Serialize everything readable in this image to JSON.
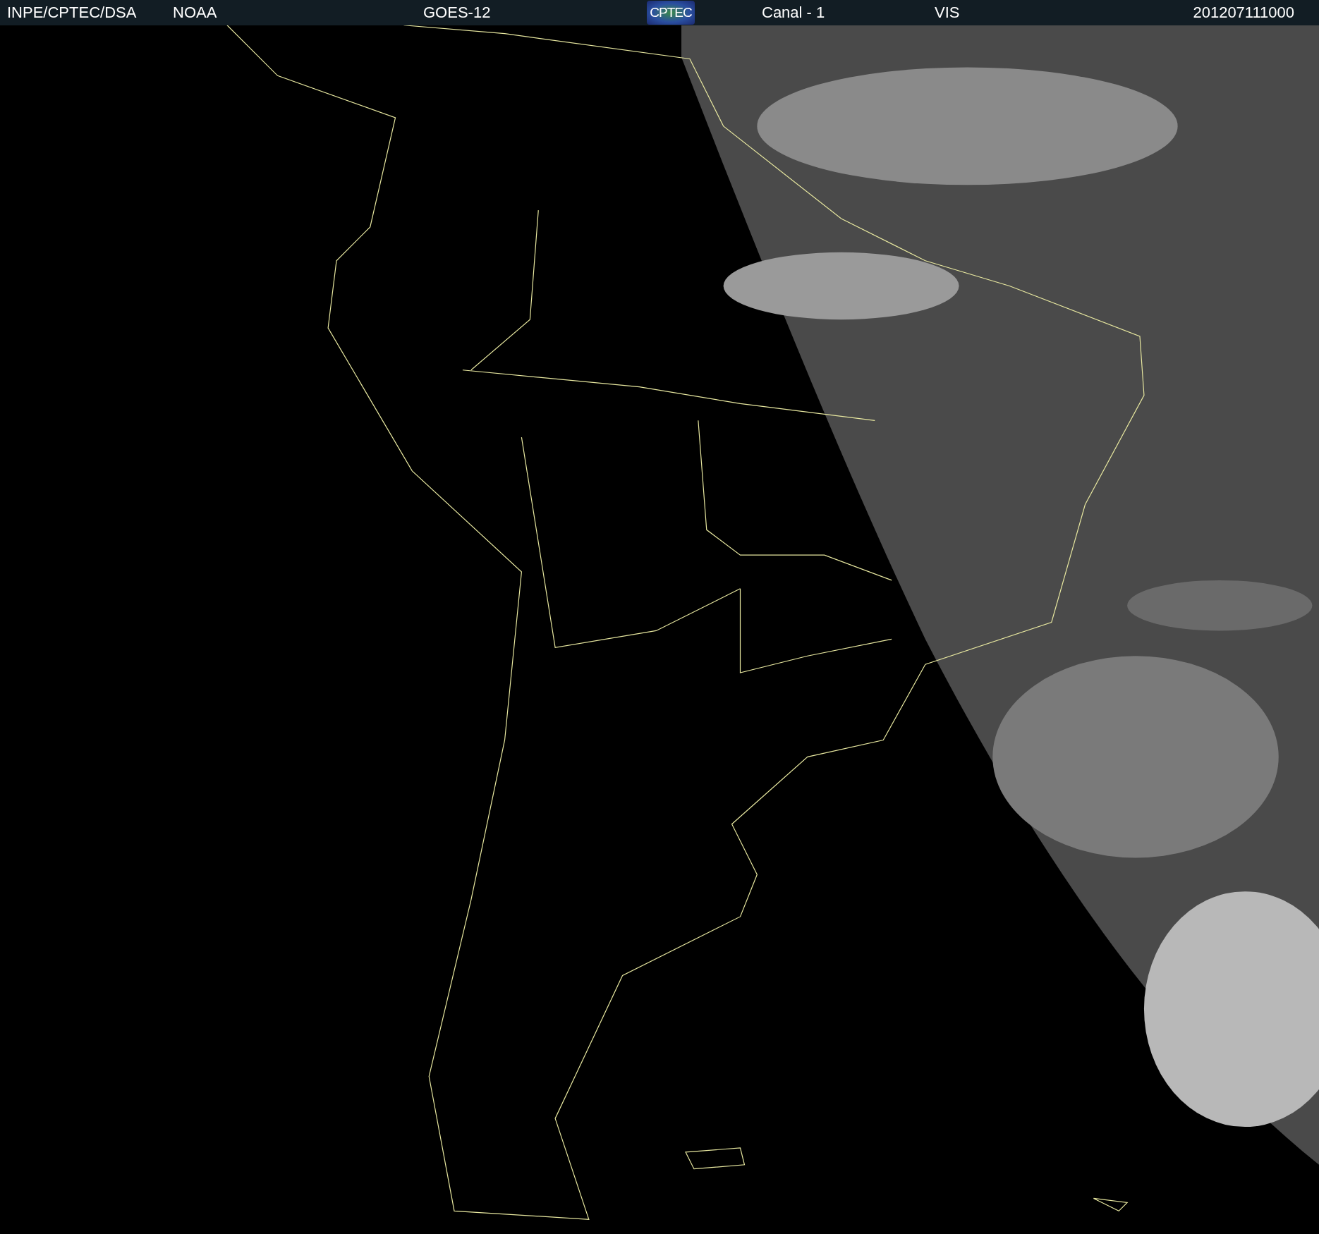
{
  "header": {
    "source": "INPE/CPTEC/DSA",
    "agency": "NOAA",
    "satellite": "GOES-12",
    "logo": "CPTEC",
    "channel": "Canal - 1",
    "band": "VIS",
    "timestamp": "201207111000"
  }
}
